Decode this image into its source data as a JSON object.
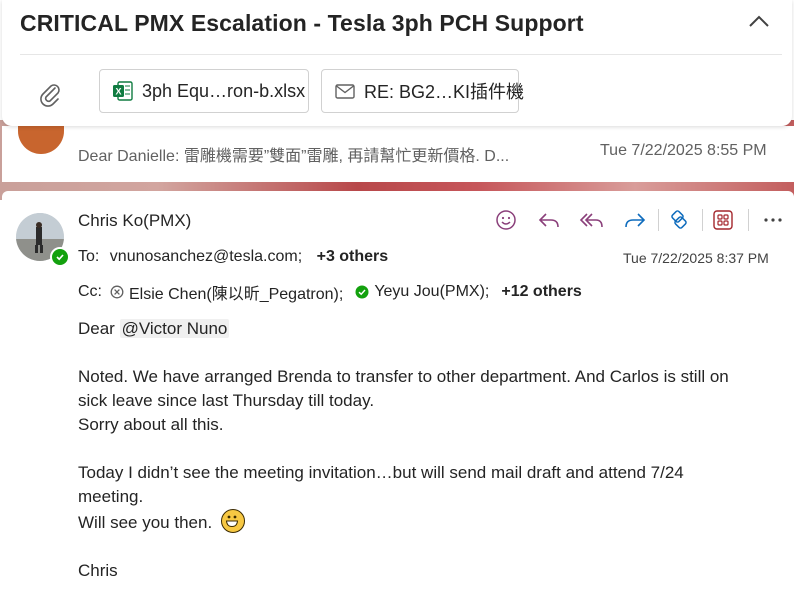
{
  "subject": "CRITICAL PMX Escalation - Tesla 3ph PCH Support",
  "attachments": [
    {
      "name": "3ph Equ…ron-b.xlsx",
      "type": "excel"
    },
    {
      "name": "RE: BG2…KI插件機",
      "type": "email"
    }
  ],
  "collapsed_message": {
    "preview": "Dear Danielle: 雷雕機需要”雙面”雷雕, 再請幫忙更新價格. D...",
    "date": "Tue 7/22/2025 8:55 PM"
  },
  "message": {
    "sender": "Chris Ko(PMX)",
    "to_label": "To:",
    "to": "vnunosanchez@tesla.com;",
    "to_more": "+3 others",
    "date": "Tue 7/22/2025 8:37 PM",
    "cc_label": "Cc:",
    "cc": [
      {
        "name": "Elsie Chen(陳以昕_Pegatron);",
        "status": "blocked"
      },
      {
        "name": "Yeyu Jou(PMX);",
        "status": "available"
      }
    ],
    "cc_more": "+12 others",
    "body": {
      "greeting": "Dear ",
      "mention": "@Victor Nuno",
      "para1_line1": "Noted. We have arranged Brenda to transfer to other department. And Carlos is still on",
      "para1_line2": "sick leave since last Thursday till today.",
      "para1_line3": "Sorry about all this.",
      "para2_line1": "Today I didn’t see the meeting invitation…but will send mail draft and attend 7/24",
      "para2_line2": "meeting.",
      "para2_line3": "Will see you then.",
      "signature": "Chris"
    }
  },
  "colors": {
    "accent": "#0f6cbd",
    "reply_purple": "#8a3f7a",
    "presence_green": "#13a10e",
    "excel_green": "#107c41"
  }
}
